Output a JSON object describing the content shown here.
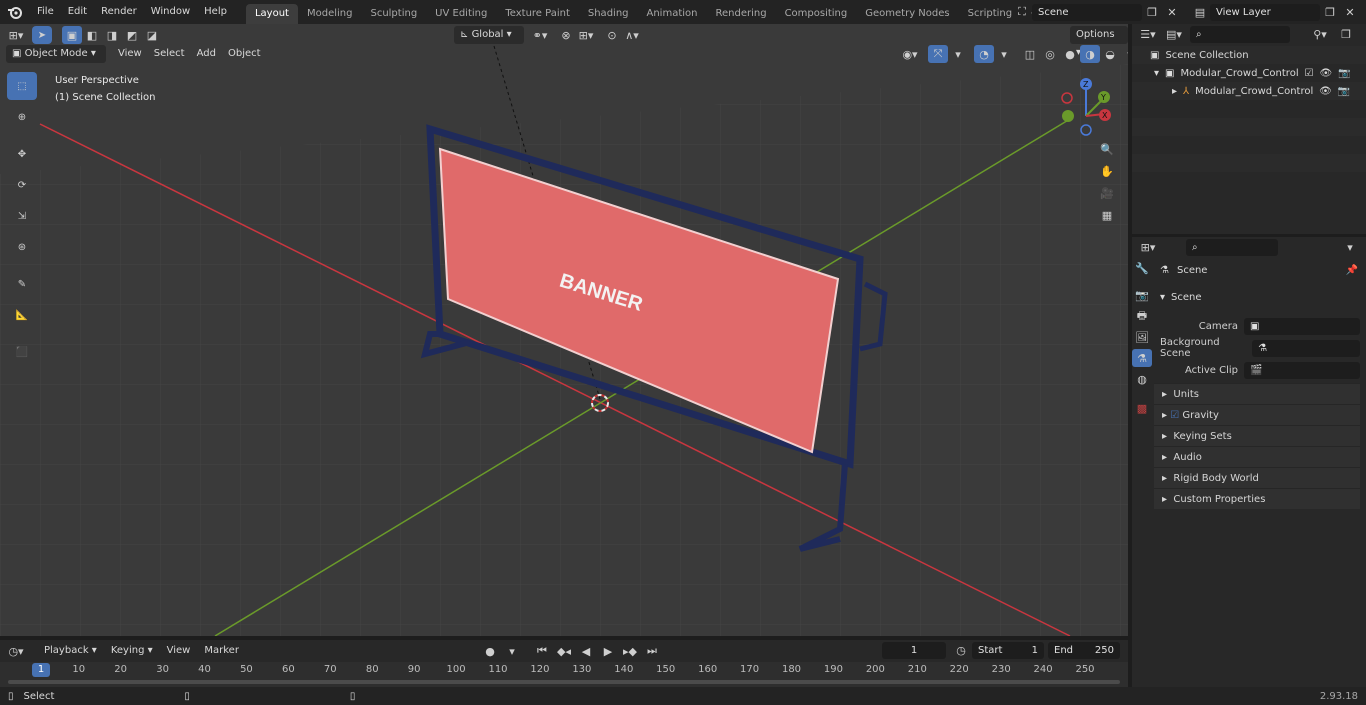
{
  "topbar": {
    "menus": [
      "File",
      "Edit",
      "Render",
      "Window",
      "Help"
    ],
    "workspaces": [
      "Layout",
      "Modeling",
      "Sculpting",
      "UV Editing",
      "Texture Paint",
      "Shading",
      "Animation",
      "Rendering",
      "Compositing",
      "Geometry Nodes",
      "Scripting"
    ],
    "active_workspace": "Layout",
    "add_workspace": "+",
    "scene_name": "Scene",
    "view_layer_name": "View Layer"
  },
  "viewport": {
    "mode": "Object Mode",
    "menus": [
      "View",
      "Select",
      "Add",
      "Object"
    ],
    "transform_orientation": "Global",
    "options_label": "Options",
    "overlay_title": "User Perspective",
    "overlay_subtitle": "(1) Scene Collection",
    "banner_text": "BANNER",
    "gizmo": {
      "z": "Z",
      "y": "Y",
      "x": "X"
    },
    "colors": {
      "background": "#3a3a3a",
      "grid": "#4a4a4a",
      "x_axis": "#c8363f",
      "y_axis": "#6a9a2a",
      "barrier_frame": "#1f2a5a",
      "banner": "#e06a6a"
    }
  },
  "outliner": {
    "root": "Scene Collection",
    "items": [
      {
        "label": "Modular_Crowd_Control_Barr",
        "level": 1
      },
      {
        "label": "Modular_Crowd_Control_",
        "level": 2
      }
    ]
  },
  "properties": {
    "context_title": "Scene",
    "section": "Scene",
    "fields": [
      {
        "label": "Camera"
      },
      {
        "label": "Background Scene"
      },
      {
        "label": "Active Clip"
      }
    ],
    "panels": [
      "Units",
      "Gravity",
      "Keying Sets",
      "Audio",
      "Rigid Body World",
      "Custom Properties"
    ]
  },
  "timeline": {
    "menus": [
      "Playback",
      "Keying",
      "View",
      "Marker"
    ],
    "current_frame": "1",
    "start_label": "Start",
    "start_value": "1",
    "end_label": "End",
    "end_value": "250",
    "ruler": [
      "1",
      "10",
      "20",
      "30",
      "40",
      "50",
      "60",
      "70",
      "80",
      "90",
      "100",
      "110",
      "120",
      "130",
      "140",
      "150",
      "160",
      "170",
      "180",
      "190",
      "200",
      "210",
      "220",
      "230",
      "240",
      "250"
    ]
  },
  "statusbar": {
    "left_text": "Select",
    "version": "2.93.18"
  }
}
